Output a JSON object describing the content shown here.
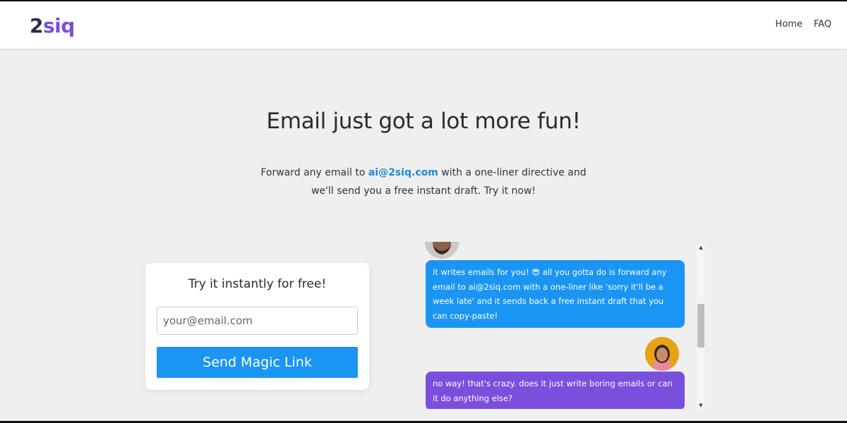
{
  "header": {
    "logo_num": "2",
    "logo_txt": "siq",
    "nav": {
      "home": "Home",
      "faq": "FAQ"
    }
  },
  "hero": {
    "title": "Email just got a lot more fun!",
    "sub_part1": "Forward any email to ",
    "email": "ai@2siq.com",
    "sub_part2": " with a one-liner directive and we'll send you a free instant draft. Try it now!"
  },
  "card": {
    "title": "Try it instantly for free!",
    "email_placeholder": "your@email.com",
    "button_label": "Send Magic Link"
  },
  "chat": {
    "messages": [
      {
        "text": "it writes emails for you! 😎 all you gotta do is forward any email to ai@2siq.com with a one-liner like 'sorry it'll be a week late' and it sends back a free instant draft that you can copy-paste!",
        "color": "#1a95f3"
      },
      {
        "text": "no way! that's crazy. does it just write boring emails or can it do anything else?",
        "color": "#7b4fdd"
      }
    ]
  },
  "colors": {
    "background": "#efefef",
    "accent_blue": "#1a95f3",
    "accent_purple": "#7b4fdd",
    "logo_purple": "#7a4fd6"
  }
}
